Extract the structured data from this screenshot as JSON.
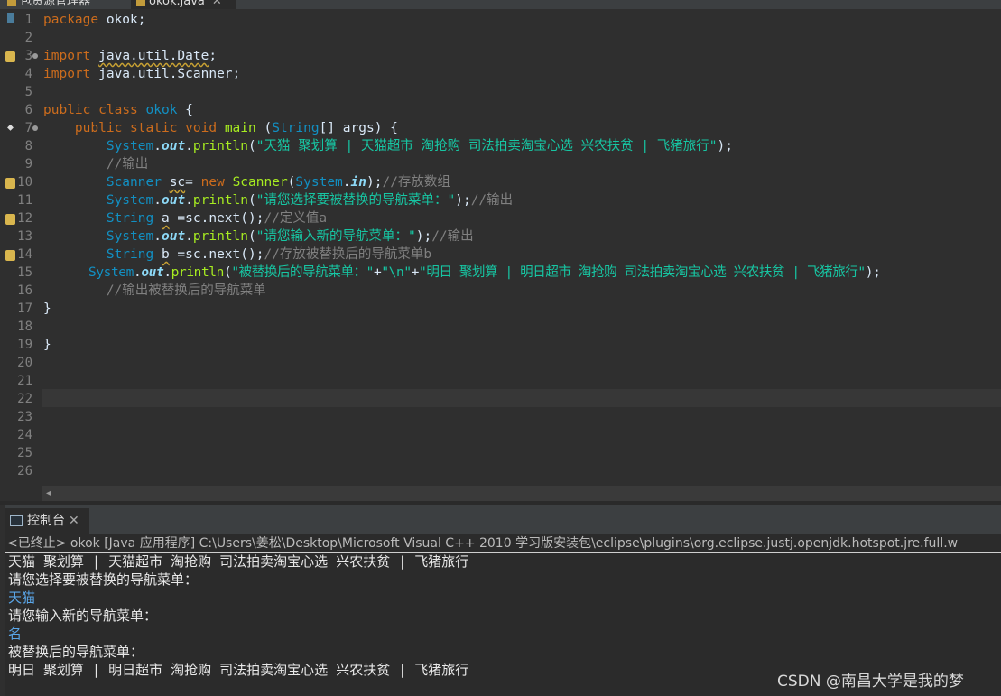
{
  "tabs": {
    "package_explorer": "包资源管理器",
    "editor_file": "okok.java",
    "console": "控制台"
  },
  "editor": {
    "line_numbers": [
      "1",
      "2",
      "3",
      "4",
      "5",
      "6",
      "7",
      "8",
      "9",
      "10",
      "11",
      "12",
      "13",
      "14",
      "15",
      "16",
      "17",
      "18",
      "19",
      "20",
      "21",
      "22",
      "23",
      "24",
      "25",
      "26"
    ],
    "lines": {
      "l1_kw": "package",
      "l1_rest": " okok;",
      "l3_kw": "import",
      "l3_rest": "java.util.Date",
      "l4_kw": "import",
      "l4_rest": " java.util.Scanner;",
      "l6_kw1": "public",
      "l6_kw2": "class",
      "l6_name": "okok",
      "l6_brace": " {",
      "l7_kw1": "public",
      "l7_kw2": "static",
      "l7_kw3": "void",
      "l7_fn": "main",
      "l7_type": "String",
      "l7_rest": "[] args) {",
      "l8_sys": "System",
      "l8_out": "out",
      "l8_fn": "println",
      "l8_str": "\"天猫 聚划算 | 天猫超市 淘抢购 司法拍卖淘宝心选 兴农扶贫 | 飞猪旅行\"",
      "l9_cm": "//输出",
      "l10_type": "Scanner",
      "l10_var": "sc",
      "l10_kw": "new",
      "l10_fn": "Scanner",
      "l10_sys": "System",
      "l10_in": "in",
      "l10_cm": "//存放数组",
      "l11_sys": "System",
      "l11_out": "out",
      "l11_fn": "println",
      "l11_str": "\"请您选择要被替换的导航菜单：\"",
      "l11_cm": "//输出",
      "l12_type": "String",
      "l12_var": "a",
      "l12_rest": " =sc.next();",
      "l12_cm": "//定义值a",
      "l13_sys": "System",
      "l13_out": "out",
      "l13_fn": "println",
      "l13_str": "\"请您输入新的导航菜单：\"",
      "l13_cm": "//输出",
      "l14_type": "String",
      "l14_var": "b",
      "l14_rest": " =sc.next();",
      "l14_cm": "//存放被替换后的导航菜单b",
      "l15_sys": "System",
      "l15_out": "out",
      "l15_fn": "println",
      "l15_str1": "\"被替换后的导航菜单：\"",
      "l15_str2": "\"\\n\"",
      "l15_str3": "\"明日 聚划算 | 明日超市 淘抢购 司法拍卖淘宝心选 兴农扶贫 | 飞猪旅行\"",
      "l16_cm": "//输出被替换后的导航菜单",
      "l17": "}",
      "l19": "}"
    }
  },
  "console": {
    "terminated_label": "<已终止> okok [Java 应用程序] C:\\Users\\姜松\\Desktop\\Microsoft Visual C++ 2010 学习版安装包\\eclipse\\plugins\\org.eclipse.justj.openjdk.hotspot.jre.full.w",
    "output": [
      "天猫 聚划算 | 天猫超市 淘抢购 司法拍卖淘宝心选 兴农扶贫 | 飞猪旅行",
      "请您选择要被替换的导航菜单：",
      "天猫",
      "请您输入新的导航菜单：",
      "名",
      "被替换后的导航菜单：",
      "明日 聚划算 | 明日超市 淘抢购 司法拍卖淘宝心选 兴农扶贫 | 飞猪旅行"
    ]
  },
  "watermark": "CSDN @南昌大学是我的梦"
}
